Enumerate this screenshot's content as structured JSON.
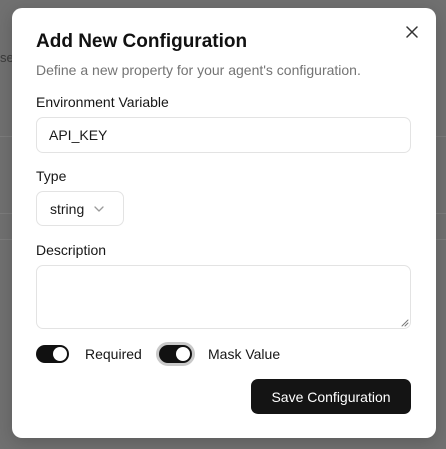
{
  "background": {
    "partial_text": "se"
  },
  "dialog": {
    "title": "Add New Configuration",
    "subtitle": "Define a new property for your agent's configuration.",
    "close_icon": "close-icon"
  },
  "fields": {
    "env_var": {
      "label": "Environment Variable",
      "value": "API_KEY"
    },
    "type": {
      "label": "Type",
      "value": "string",
      "icon": "chevron-down-icon"
    },
    "description": {
      "label": "Description",
      "value": ""
    }
  },
  "toggles": {
    "required": {
      "label": "Required",
      "checked": true
    },
    "mask_value": {
      "label": "Mask Value",
      "checked": true,
      "focused": true
    }
  },
  "actions": {
    "save_label": "Save Configuration"
  },
  "colors": {
    "primary": "#141414",
    "overlay": "#707070",
    "muted_text": "#747474",
    "border": "#e3e3e3"
  }
}
